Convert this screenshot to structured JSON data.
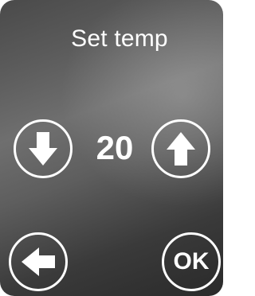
{
  "screen": {
    "title": "Set temp",
    "temperature_value": "20"
  },
  "buttons": {
    "decrease_icon": "arrow-down-icon",
    "increase_icon": "arrow-up-icon",
    "back_icon": "arrow-left-icon",
    "ok_label": "OK"
  },
  "colors": {
    "foreground": "#ffffff",
    "background_dark": "#2a2a2a",
    "background_light": "#6f6f6f"
  }
}
